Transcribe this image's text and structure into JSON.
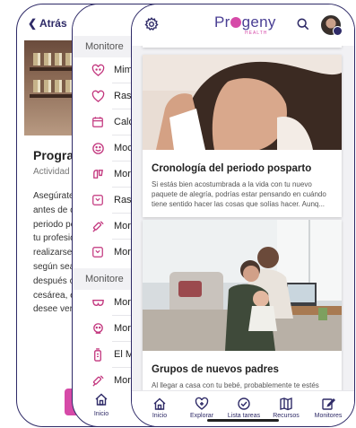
{
  "back_screen": {
    "back_label": "Atrás",
    "title": "Program",
    "subtitle": "Actividad p",
    "body_lines": [
      "Asegúrate",
      "antes de c",
      "periodo pe",
      "tu profesic",
      "realizarse",
      "según sea",
      "después c",
      "cesárea, e",
      "desee vert"
    ]
  },
  "middle_screen": {
    "section1": "Monitore",
    "section2": "Monitore",
    "items1": [
      {
        "label": "Mim",
        "icon": "heart-face-icon"
      },
      {
        "label": "Ras",
        "icon": "heart-outline-icon"
      },
      {
        "label": "Calc",
        "icon": "calendar-icon"
      },
      {
        "label": "Moc",
        "icon": "smile-face-icon"
      },
      {
        "label": "Mor",
        "icon": "cup-icon"
      },
      {
        "label": "Ras",
        "icon": "scale-icon"
      },
      {
        "label": "Mor",
        "icon": "syringe-icon"
      },
      {
        "label": "Mor",
        "icon": "scale-icon"
      }
    ],
    "items2": [
      {
        "label": "Mor",
        "icon": "bra-icon"
      },
      {
        "label": "Mor",
        "icon": "baby-icon"
      },
      {
        "label": "El M",
        "icon": "bottle-icon"
      },
      {
        "label": "Mor",
        "icon": "syringe-icon"
      }
    ],
    "tab_label": "Inicio"
  },
  "front_screen": {
    "brand": {
      "pre": "Pr",
      "post": "geny",
      "sub": "HEALTH"
    },
    "cards": [
      {
        "title": "Cronología del periodo posparto",
        "text": "Si estás bien acostumbrada a la vida con tu nuevo paquete de alegría, podrías estar pensando en cuándo tiene sentido hacer las cosas que solías hacer. Aunq..."
      },
      {
        "title": "Grupos de nuevos padres",
        "text": "Al llegar a casa con tu bebé, probablemente te estés adaptando a una nueva \"normalidad\". Es posible que"
      }
    ],
    "tabs": [
      {
        "label": "Inicio",
        "icon": "home-icon"
      },
      {
        "label": "Explorar",
        "icon": "explore-icon"
      },
      {
        "label": "Lista tareas",
        "icon": "checklist-icon"
      },
      {
        "label": "Recursos",
        "icon": "resources-icon"
      },
      {
        "label": "Monitores",
        "icon": "edit-icon"
      }
    ]
  },
  "colors": {
    "brand_navy": "#2e2a67",
    "brand_pink": "#d64aa8",
    "icon_pink": "#c2357d"
  }
}
